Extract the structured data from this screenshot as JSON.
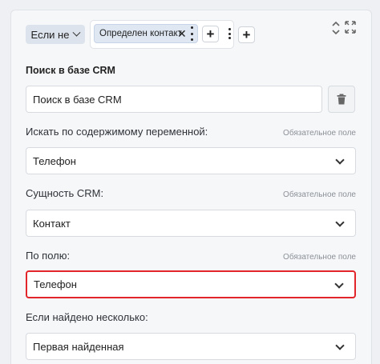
{
  "condition": {
    "operator_label": "Если не",
    "chip_label": "Определен контакт",
    "chip_remove": "✕",
    "add_label": "+",
    "add_outer_label": "+"
  },
  "block": {
    "title": "Поиск в базе CRM",
    "name_value": "Поиск в базе CRM"
  },
  "fields": [
    {
      "label": "Искать по содержимому переменной:",
      "required": "Обязательное поле",
      "value": "Телефон"
    },
    {
      "label": "Сущность CRM:",
      "required": "Обязательное поле",
      "value": "Контакт"
    },
    {
      "label": "По полю:",
      "required": "Обязательное поле",
      "value": "Телефон"
    },
    {
      "label": "Если найдено несколько:",
      "value": "Первая найденная"
    }
  ],
  "colors": {
    "highlight": "#e2242b",
    "chip_bg": "#dfe7f3",
    "operator_bg": "#dde3ec"
  }
}
